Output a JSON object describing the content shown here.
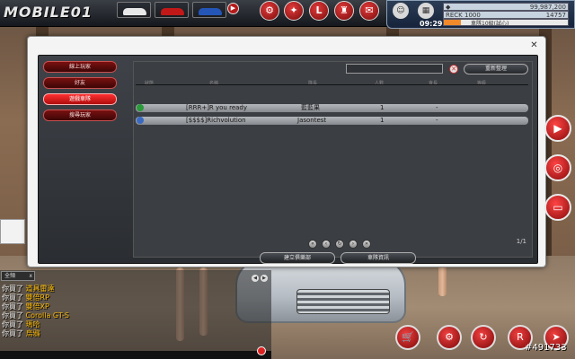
{
  "game": {
    "logo": "MOBILE01",
    "clock": "09:29"
  },
  "stats": {
    "money_value": "99,987,200",
    "points_label": "RECK 1000",
    "points_value": "14757",
    "exp_text": "車隊10級(試心)",
    "exp_fraction": 0.14
  },
  "sidebar": {
    "items": [
      {
        "label": "線上玩家"
      },
      {
        "label": "好友"
      },
      {
        "label": "遊戲車隊"
      },
      {
        "label": "搜尋玩家"
      }
    ],
    "active_index": 2
  },
  "room_list": {
    "refresh_label": "重新整理",
    "headers": [
      "狀態",
      "名稱",
      "隊長",
      "人數",
      "會長",
      "等級"
    ],
    "rows": [
      {
        "name": "[RRR+]R you ready",
        "leader": "藍藍果",
        "count": "1",
        "extra": "-"
      },
      {
        "name": "[$$$$]Richvolution",
        "leader": "Jasontest",
        "count": "1",
        "extra": "-"
      }
    ],
    "page": "1/1",
    "buttons": {
      "create": "建立俱樂部",
      "info": "車隊資訊"
    }
  },
  "chat": {
    "tab_label": "全頻",
    "tab_close": "x",
    "lines": [
      {
        "prefix": "你買了",
        "item": "道具雷達"
      },
      {
        "prefix": "你買了",
        "item": "雙倍RP"
      },
      {
        "prefix": "你買了",
        "item": "雙倍XP"
      },
      {
        "prefix": "你買了",
        "item": "Corolla GT-S"
      },
      {
        "prefix": "你買了",
        "item": "瑪哈"
      },
      {
        "prefix": "你買了",
        "item": "烏鴉"
      }
    ]
  },
  "watermark": "#491733",
  "colors": {
    "accent_red": "#e02020",
    "panel_dark": "#2a2d31",
    "chat_item": "#f5b400"
  }
}
